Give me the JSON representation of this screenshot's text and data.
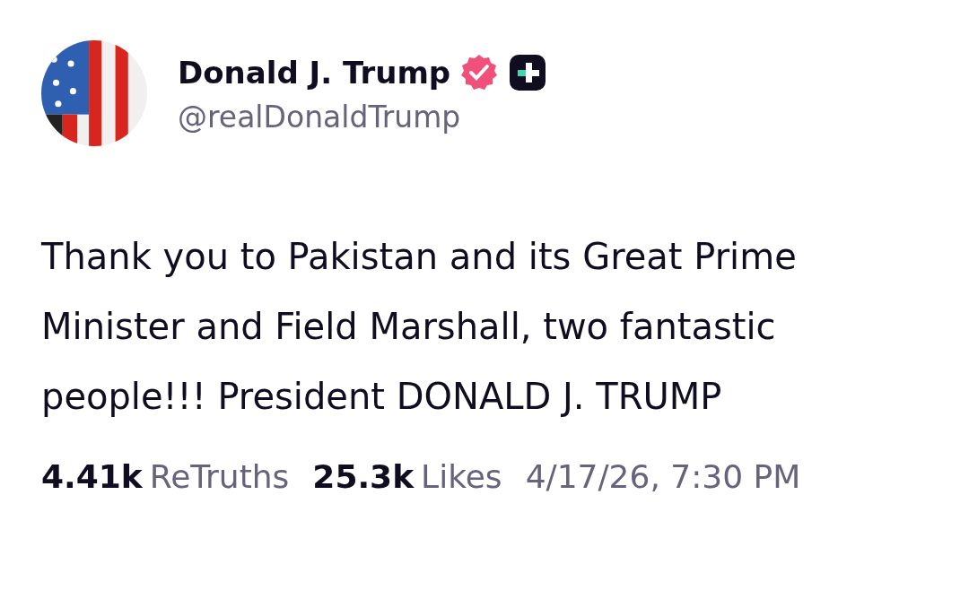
{
  "author": {
    "name": "Donald J. Trump",
    "verified": true,
    "handle": "@realDonaldTrump"
  },
  "post": {
    "text": "Thank you to Pakistan and its Great Prime Minister and Field Marshall, two fantastic people!!! President DONALD J. TRUMP"
  },
  "stats": [
    {
      "count": "4.41k",
      "label": "ReTruths"
    },
    {
      "count": "25.3k",
      "label": "Likes"
    }
  ],
  "timestamp": "4/17/26, 7:30 PM"
}
